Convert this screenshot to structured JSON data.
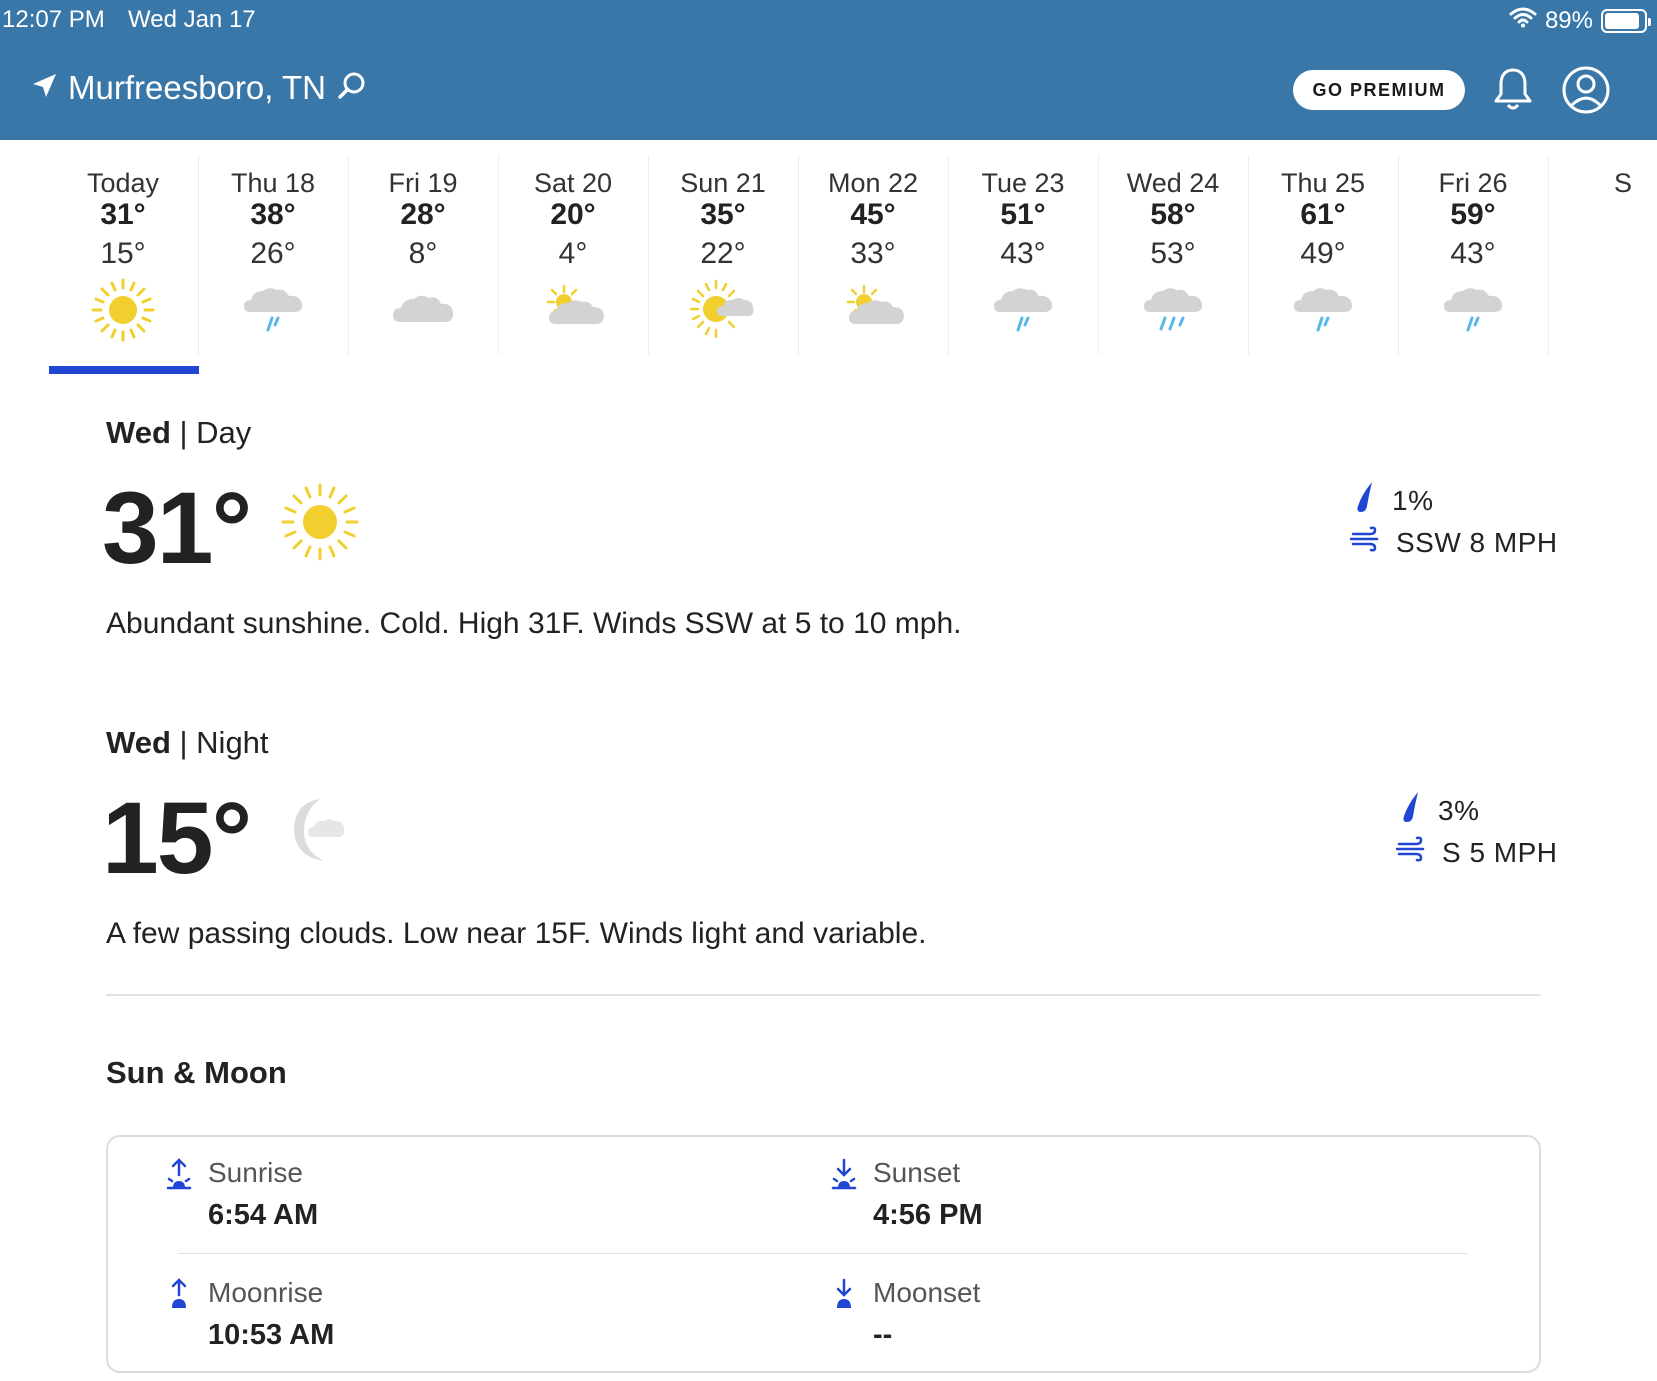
{
  "status_bar": {
    "time": "12:07 PM",
    "date": "Wed Jan 17",
    "battery": "89%",
    "battery_level": 0.89
  },
  "header": {
    "location": "Murfreesboro, TN",
    "premium_label": "GO PREMIUM",
    "icons": [
      "location-arrow-icon",
      "search-icon",
      "bell-icon",
      "account-icon"
    ]
  },
  "days": [
    {
      "name": "Today",
      "high": "31°",
      "low": "15°",
      "icon": "sunny"
    },
    {
      "name": "Thu 18",
      "high": "38°",
      "low": "26°",
      "icon": "rain"
    },
    {
      "name": "Fri 19",
      "high": "28°",
      "low": "8°",
      "icon": "cloudy"
    },
    {
      "name": "Sat 20",
      "high": "20°",
      "low": "4°",
      "icon": "partly-cloudy"
    },
    {
      "name": "Sun 21",
      "high": "35°",
      "low": "22°",
      "icon": "mostly-sunny"
    },
    {
      "name": "Mon 22",
      "high": "45°",
      "low": "33°",
      "icon": "partly-cloudy"
    },
    {
      "name": "Tue 23",
      "high": "51°",
      "low": "43°",
      "icon": "rain"
    },
    {
      "name": "Wed 24",
      "high": "58°",
      "low": "53°",
      "icon": "showers"
    },
    {
      "name": "Thu 25",
      "high": "61°",
      "low": "49°",
      "icon": "rain"
    },
    {
      "name": "Fri 26",
      "high": "59°",
      "low": "43°",
      "icon": "rain"
    },
    {
      "name": "S",
      "high": "",
      "low": "",
      "icon": ""
    }
  ],
  "day_detail": {
    "day": "Wed",
    "period": "Day",
    "temp": "31°",
    "icon": "sun-icon",
    "precip": "1%",
    "wind": "SSW 8 MPH",
    "description": "Abundant sunshine. Cold. High 31F. Winds SSW at 5 to 10 mph."
  },
  "night_detail": {
    "day": "Wed",
    "period": "Night",
    "temp": "15°",
    "icon": "moon-cloud-icon",
    "precip": "3%",
    "wind": "S 5 MPH",
    "description": "A few passing clouds. Low near 15F. Winds light and variable."
  },
  "sun_moon": {
    "title": "Sun & Moon",
    "sunrise_label": "Sunrise",
    "sunrise": "6:54 AM",
    "sunset_label": "Sunset",
    "sunset": "4:56 PM",
    "moonrise_label": "Moonrise",
    "moonrise": "10:53 AM",
    "moonset_label": "Moonset",
    "moonset": "--"
  },
  "colors": {
    "header": "#3a77a9",
    "accent": "#2146d4",
    "sun": "#f0cf2e",
    "cloud": "#d3d3d3",
    "rain": "#5ab8e8"
  }
}
